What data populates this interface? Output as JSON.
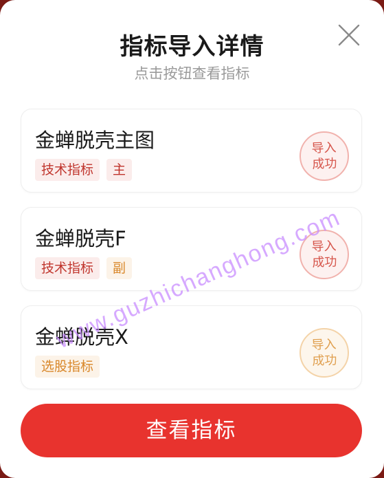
{
  "dialog": {
    "title": "指标导入详情",
    "subtitle": "点击按钮查看指标"
  },
  "items": [
    {
      "name": "金蝉脱壳主图",
      "tags": [
        {
          "label": "技术指标",
          "color": "red"
        },
        {
          "label": "主",
          "color": "red"
        }
      ],
      "status": [
        "导入",
        "成功"
      ],
      "status_color": "red"
    },
    {
      "name": "金蝉脱壳F",
      "tags": [
        {
          "label": "技术指标",
          "color": "red"
        },
        {
          "label": "副",
          "color": "orange"
        }
      ],
      "status": [
        "导入",
        "成功"
      ],
      "status_color": "red"
    },
    {
      "name": "金蝉脱壳X",
      "tags": [
        {
          "label": "选股指标",
          "color": "orange"
        }
      ],
      "status": [
        "导入",
        "成功"
      ],
      "status_color": "orange"
    }
  ],
  "button": {
    "label": "查看指标"
  },
  "watermark": "www.guzhichanghong.com",
  "colors": {
    "accent": "#e8332e",
    "tag_red": "#c0352d",
    "tag_orange": "#d9882b"
  }
}
